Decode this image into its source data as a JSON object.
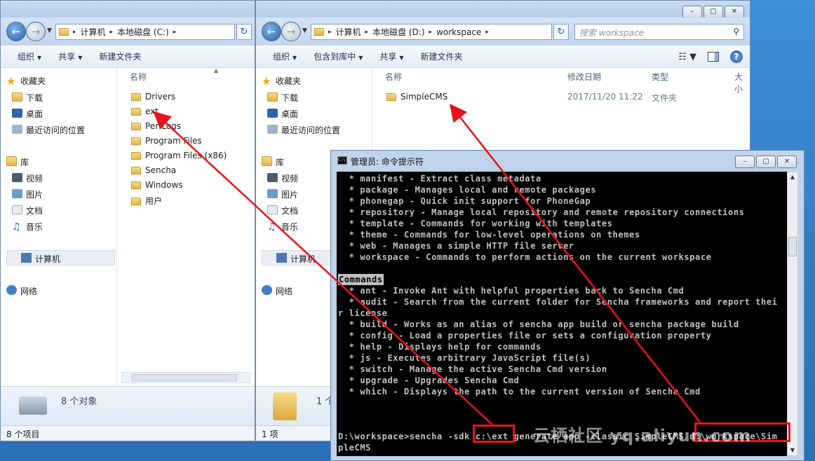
{
  "left_window": {
    "breadcrumb": [
      "计算机",
      "本地磁盘 (C:)"
    ],
    "toolbar": [
      "组织",
      "共享",
      "新建文件夹"
    ],
    "column_name": "名称",
    "nav": {
      "favorites": "收藏夹",
      "downloads": "下载",
      "desktop": "桌面",
      "recent": "最近访问的位置",
      "libraries": "库",
      "videos": "视频",
      "pictures": "图片",
      "documents": "文档",
      "music": "音乐",
      "computer": "计算机",
      "network": "网络"
    },
    "files": [
      "Drivers",
      "ext",
      "PerfLogs",
      "Program Files",
      "Program Files (x86)",
      "Sencha",
      "Windows",
      "用户"
    ],
    "details": "8 个对象",
    "status": "8 个项目"
  },
  "mid_window": {
    "breadcrumb": [
      "计算机",
      "本地磁盘 (D:)",
      "workspace"
    ],
    "search_placeholder": "搜索 workspace",
    "toolbar": [
      "组织",
      "包含到库中",
      "共享",
      "新建文件夹"
    ],
    "columns": {
      "name": "名称",
      "date": "修改日期",
      "type": "类型",
      "size": "大小"
    },
    "files": [
      {
        "name": "SimpleCMS",
        "date": "2017/11/20 11:22",
        "type": "文件夹"
      }
    ],
    "details": "1 个",
    "status": "1 项"
  },
  "cmd": {
    "title": "管理员: 命令提示符",
    "lines": [
      "  * manifest - Extract class metadata",
      "  * package - Manages local and remote packages",
      "  * phonegap - Quick init support for PhoneGap",
      "  * repository - Manage local repository and remote repository connections",
      "  * template - Commands for working with templates",
      "  * theme - Commands for low-level operations on themes",
      "  * web - Manages a simple HTTP file server",
      "  * workspace - Commands to perform actions on the current workspace",
      "",
      "Commands",
      "  * ant - Invoke Ant with helpful properties back to Sencha Cmd",
      "  * audit - Search from the current folder for Sencha frameworks and report thei",
      "r license",
      "  * build - Works as an alias of sencha app build or sencha package build",
      "  * config - Load a properties file or sets a configuration property",
      "  * help - Displays help for commands",
      "  * js - Executes arbitrary JavaScript file(s)",
      "  * switch - Manage the active Sencha Cmd version",
      "  * upgrade - Upgrades Sencha Cmd",
      "  * which - Displays the path to the current version of Sencha Cmd",
      "",
      "",
      "",
      "D:\\workspace>sencha -sdk c:\\ext generate app -classic SimpleCMS d:\\workspace\\Sim",
      "pleCMS"
    ]
  },
  "watermark": "云栖社区 yq.aliyun.com",
  "colors": {
    "annotation": "#e8141b",
    "explorer_bg": "#f4f7fb",
    "console_bg": "#000000",
    "console_fg": "#c0c0c0"
  }
}
